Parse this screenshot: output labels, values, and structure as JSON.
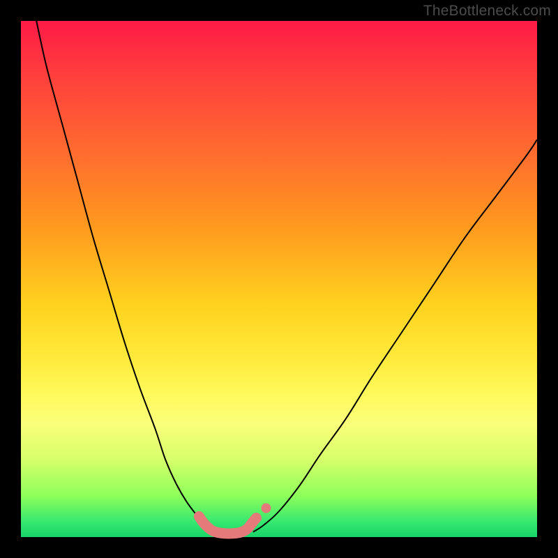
{
  "watermark": "TheBottleneck.com",
  "chart_data": {
    "type": "line",
    "title": "",
    "xlabel": "",
    "ylabel": "",
    "xlim": [
      0,
      100
    ],
    "ylim": [
      0,
      100
    ],
    "grid": false,
    "series": [
      {
        "name": "bottleneck-curve",
        "color": "#000000",
        "stroke_width": 2,
        "x": [
          3,
          5,
          8,
          11,
          14,
          17,
          20,
          23,
          26,
          28,
          30,
          32,
          34,
          35.5,
          37,
          38
        ],
        "values": [
          100,
          91,
          80,
          69,
          58,
          48,
          38,
          29,
          21,
          15,
          10.5,
          7,
          4.3,
          2.6,
          1.4,
          0.7
        ]
      },
      {
        "name": "bottleneck-curve-right",
        "color": "#000000",
        "stroke_width": 2,
        "x": [
          45,
          47,
          50,
          54,
          58,
          63,
          68,
          74,
          80,
          86,
          92,
          98,
          100
        ],
        "values": [
          1.0,
          2.3,
          5,
          10,
          16,
          23,
          31,
          40,
          49,
          58,
          66,
          74,
          77
        ]
      },
      {
        "name": "highlight-band",
        "color": "#e47a7a",
        "stroke_width": 15,
        "linecap": "round",
        "x": [
          34.5,
          35.2,
          36,
          37,
          38,
          39.5,
          41,
          42.5,
          43.6,
          44.3,
          45,
          45.6
        ],
        "values": [
          4.0,
          3.0,
          2.1,
          1.3,
          0.9,
          0.7,
          0.7,
          0.9,
          1.4,
          2.1,
          3.0,
          3.7
        ]
      },
      {
        "name": "highlight-dot",
        "type": "scatter",
        "color": "#e47a7a",
        "radius": 7,
        "x": [
          47.5
        ],
        "values": [
          5.6
        ]
      }
    ]
  }
}
